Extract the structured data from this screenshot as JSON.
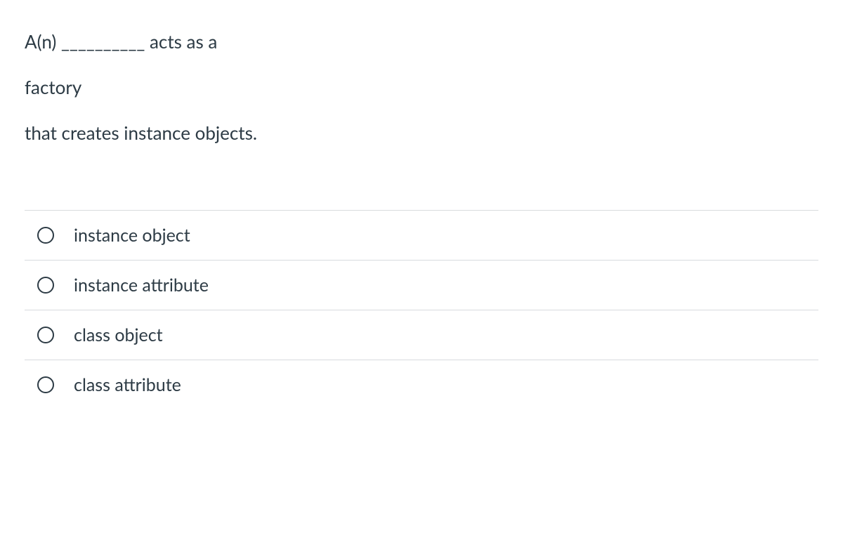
{
  "question": {
    "line1": "A(n) __________ acts as a",
    "line2": "factory",
    "line3": "that creates instance objects."
  },
  "options": [
    {
      "label": "instance object"
    },
    {
      "label": "instance attribute"
    },
    {
      "label": "class object"
    },
    {
      "label": "class attribute"
    }
  ]
}
